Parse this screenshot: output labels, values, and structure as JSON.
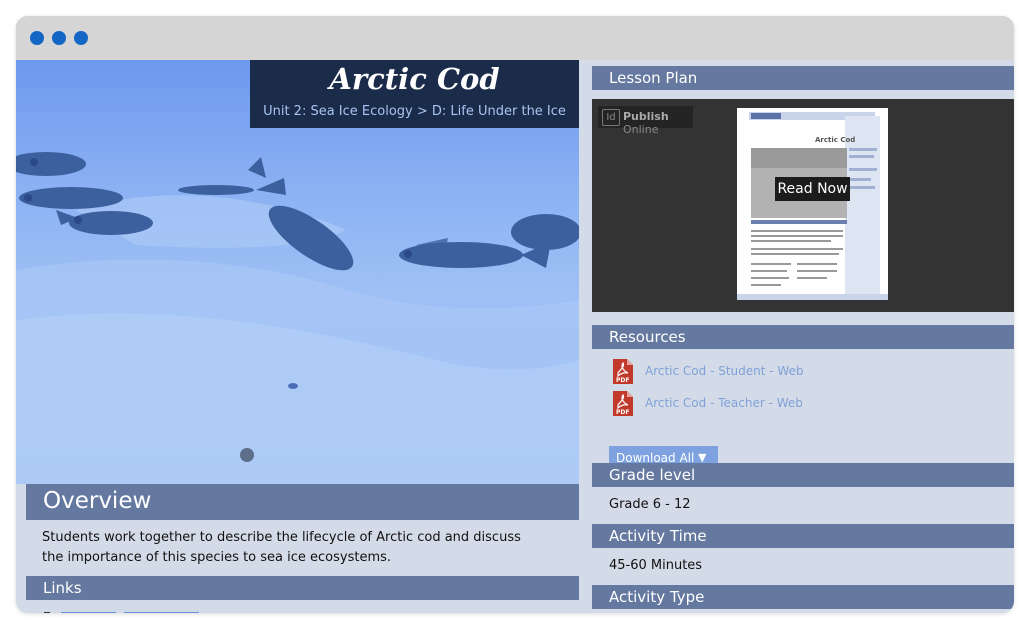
{
  "window": {
    "dots": [
      "window-close",
      "window-minimize",
      "window-maximize"
    ]
  },
  "header": {
    "title": "Arctic Cod",
    "breadcrumb": "Unit 2: Sea Ice Ecology > D: Life Under the Ice"
  },
  "overview": {
    "heading": "Overview",
    "text": "Students work together to describe the lifecycle of Arctic cod and discuss the importance of this species to sea ice ecosystems."
  },
  "links": {
    "heading": "Links"
  },
  "lesson_plan": {
    "heading": "Lesson Plan",
    "publish_brand": "Publish",
    "publish_suffix": "Online",
    "read_now": "Read Now",
    "thumbnail_title": "Arctic Cod"
  },
  "resources": {
    "heading": "Resources",
    "items": [
      {
        "label": "Arctic Cod - Student - Web",
        "icon": "pdf-icon"
      },
      {
        "label": "Arctic Cod - Teacher - Web",
        "icon": "pdf-icon"
      }
    ],
    "download_all": "Download All",
    "download_arrow": "▼"
  },
  "grade_level": {
    "heading": "Grade level",
    "value": "Grade 6 - 12"
  },
  "activity_time": {
    "heading": "Activity Time",
    "value": "45-60 Minutes"
  },
  "activity_type": {
    "heading": "Activity Type"
  },
  "colors": {
    "accent_bar": "#6478a0",
    "title_box": "#1b2b4a",
    "link": "#7fa0d8",
    "button": "#7ea2df",
    "window_dot": "#1466c4"
  }
}
